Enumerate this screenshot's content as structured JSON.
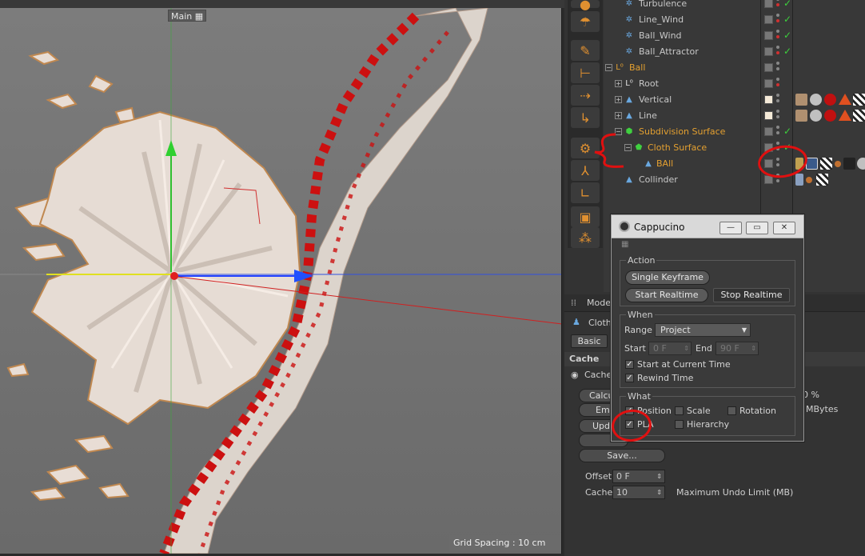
{
  "viewport": {
    "title": "Main",
    "grid_label": "Grid Spacing : 10 cm"
  },
  "objects": [
    {
      "name": "Turbulence",
      "highlight": false
    },
    {
      "name": "Line_Wind",
      "highlight": false
    },
    {
      "name": "Ball_Wind",
      "highlight": false
    },
    {
      "name": "Ball_Attractor",
      "highlight": false
    },
    {
      "name": "Ball",
      "highlight": true
    },
    {
      "name": "Root",
      "highlight": false
    },
    {
      "name": "Vertical",
      "highlight": false
    },
    {
      "name": "Line",
      "highlight": false
    },
    {
      "name": "Subdivision Surface",
      "highlight": true
    },
    {
      "name": "Cloth Surface",
      "highlight": true
    },
    {
      "name": "BAll",
      "highlight": true
    },
    {
      "name": "Collinder",
      "highlight": false
    }
  ],
  "attributes": {
    "mode_tab": "Mode",
    "object_name": "Cloth",
    "basic_tab": "Basic",
    "section": "Cache",
    "cache_radio": "Cache",
    "btn_calc": "Calcu",
    "btn_empty": "Em",
    "btn_update": "Upd",
    "btn_save": "Save...",
    "percent": "0 %",
    "mbytes": "MBytes",
    "offset_label": "Offset",
    "offset_value": "0 F",
    "cache_label": "Cache",
    "cache_value": "10",
    "undo_limit": "Maximum Undo Limit (MB)"
  },
  "dialog": {
    "title": "Cappucino",
    "action": {
      "title": "Action",
      "single_keyframe": "Single Keyframe",
      "start_realtime": "Start Realtime",
      "stop_realtime": "Stop Realtime"
    },
    "when": {
      "title": "When",
      "range_label": "Range",
      "range_value": "Project",
      "start_label": "Start",
      "start_value": "0 F",
      "end_label": "End",
      "end_value": "90 F",
      "start_at_current": "Start at Current Time",
      "rewind_time": "Rewind Time"
    },
    "what": {
      "title": "What",
      "position": "Position",
      "scale": "Scale",
      "rotation": "Rotation",
      "pla": "PLA",
      "hierarchy": "Hierarchy"
    }
  },
  "colors": {
    "highlight_text": "#e4a030",
    "annotation_red": "#e01010",
    "check_green": "#3cd03c"
  }
}
